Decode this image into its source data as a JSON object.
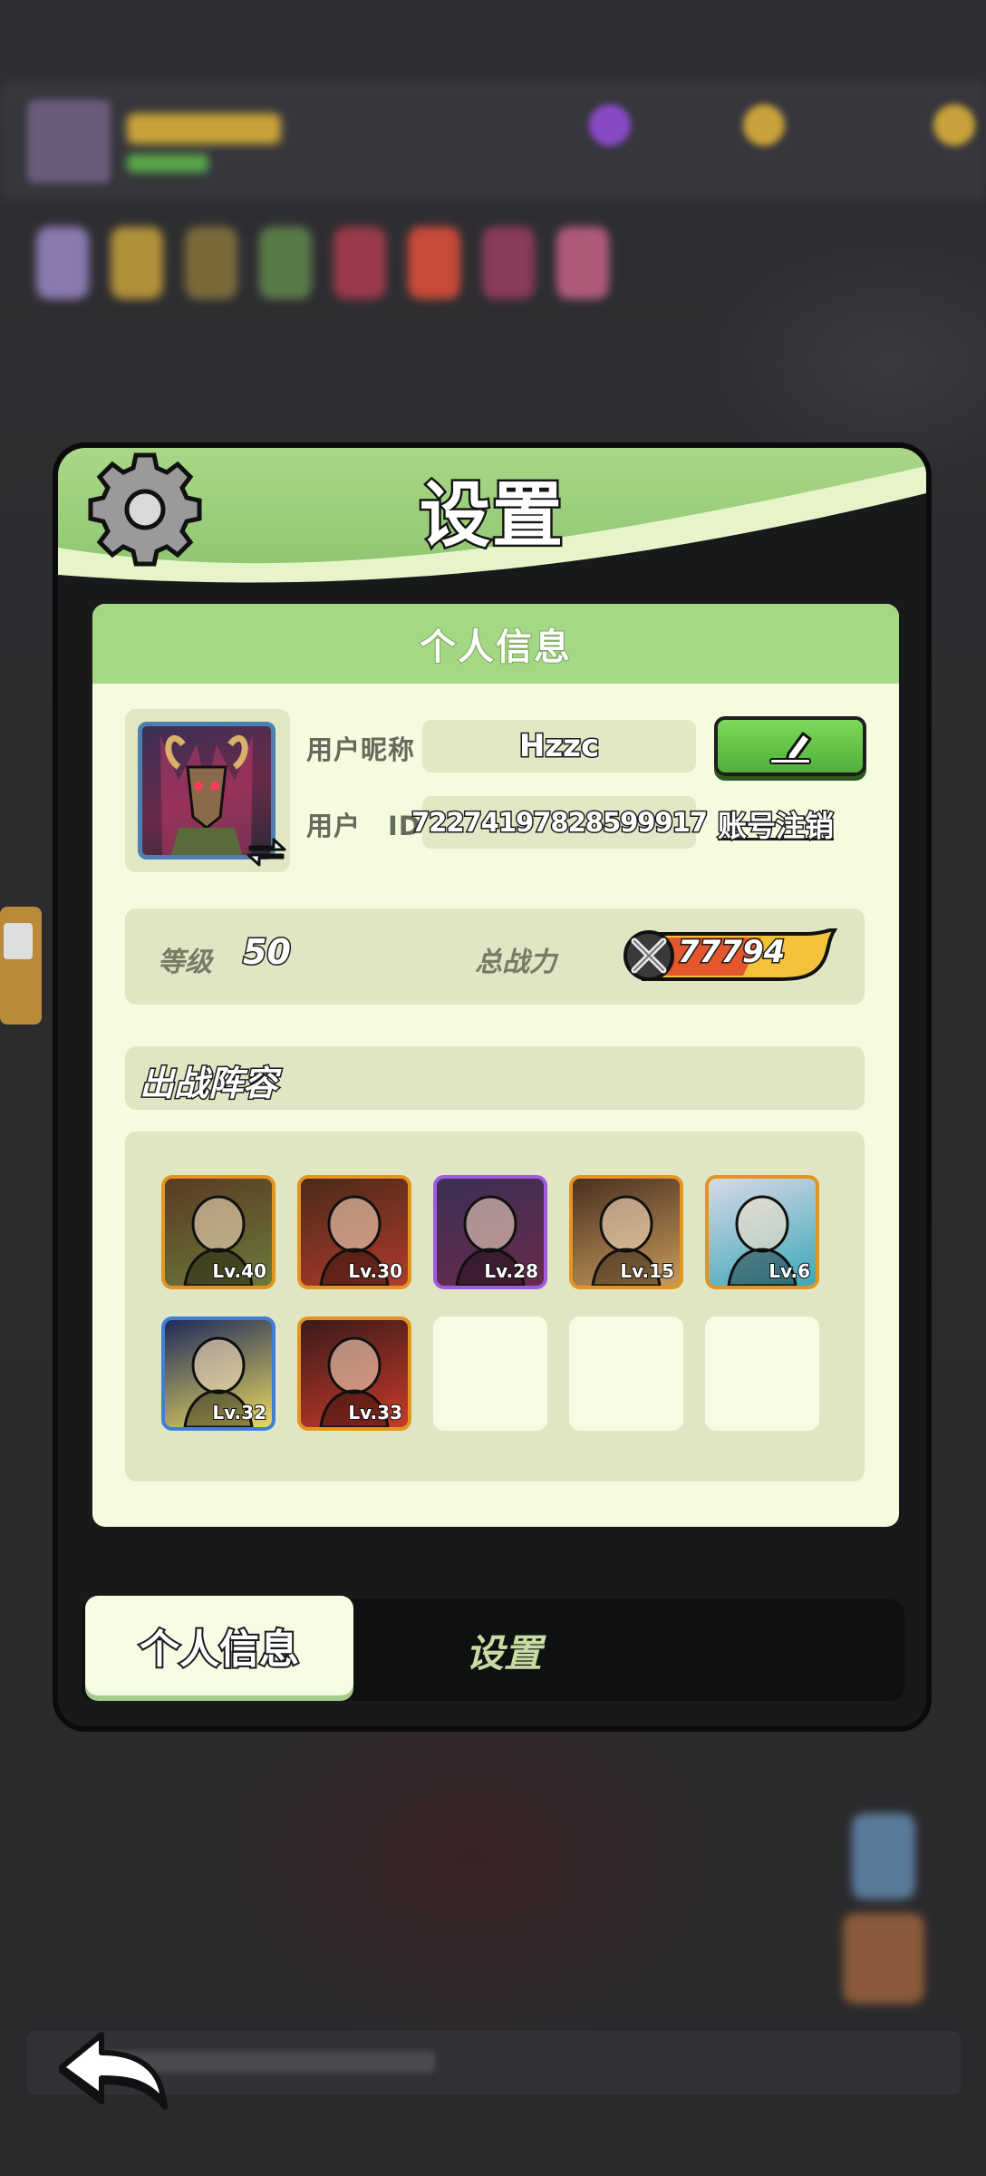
{
  "panel": {
    "title": "设置"
  },
  "profile": {
    "section_title": "个人信息",
    "nickname_label": "用户昵称",
    "nickname": "Hzzc",
    "id_label": "用户　ID",
    "user_id": "72274197828599917",
    "cancel_account": "账号注销"
  },
  "stats": {
    "level_label": "等级",
    "level": "50",
    "power_label": "总战力",
    "power": "77794"
  },
  "team": {
    "title": "出战阵容",
    "heroes": [
      {
        "level": "Lv.40",
        "frame": "orange",
        "icon": "crocodile-hero-icon",
        "colors": [
          "#5a3a22",
          "#6b7a3a"
        ]
      },
      {
        "level": "Lv.30",
        "frame": "orange",
        "icon": "dwarf-king-hero-icon",
        "colors": [
          "#4a2a1a",
          "#b03a2a"
        ]
      },
      {
        "level": "Lv.28",
        "frame": "purple",
        "icon": "goat-demon-hero-icon",
        "colors": [
          "#3a3055",
          "#6a2a4a"
        ]
      },
      {
        "level": "Lv.15",
        "frame": "orange",
        "icon": "bard-hero-icon",
        "colors": [
          "#4a3022",
          "#c89a5a"
        ]
      },
      {
        "level": "Lv.6",
        "frame": "orange",
        "icon": "dancer-hero-icon",
        "colors": [
          "#d8d8e8",
          "#3aa8b8"
        ]
      },
      {
        "level": "Lv.32",
        "frame": "blue",
        "icon": "blonde-knight-hero-icon",
        "colors": [
          "#1e2a5a",
          "#e8d860"
        ]
      },
      {
        "level": "Lv.33",
        "frame": "orange",
        "icon": "red-hair-hero-icon",
        "colors": [
          "#3a1a1a",
          "#c83a2a"
        ]
      }
    ],
    "empty_slots": 3
  },
  "tabs": {
    "profile": "个人信息",
    "settings": "设置"
  },
  "colors": {
    "header_green": "#8cc46e",
    "card_bg": "#f4fbdf",
    "orange_frame": "#e3951f",
    "purple_frame": "#a05ae0",
    "blue_frame": "#3f7fd8"
  }
}
